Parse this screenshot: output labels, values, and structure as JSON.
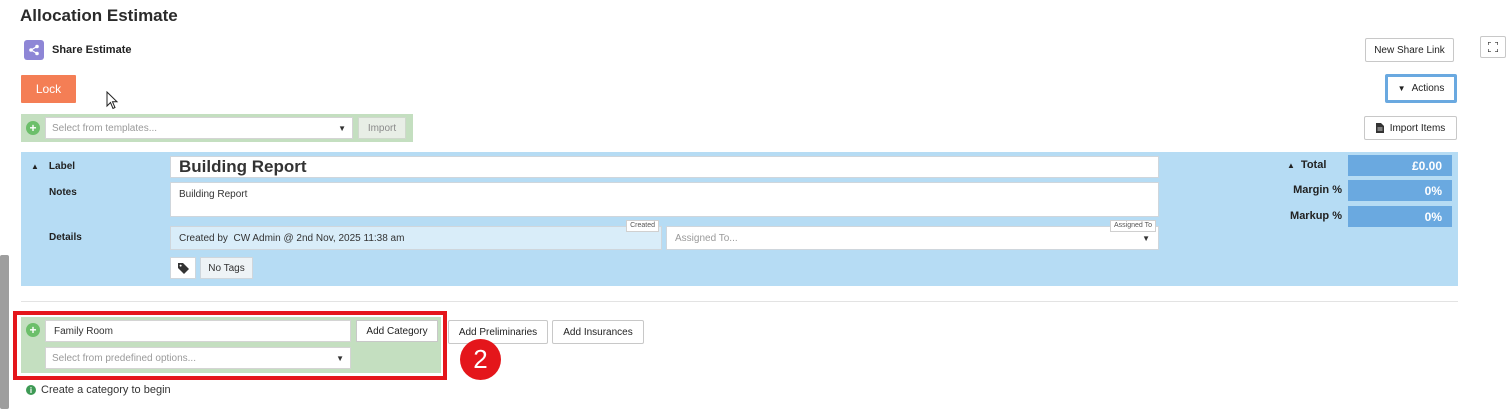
{
  "page": {
    "title": "Allocation Estimate"
  },
  "share": {
    "label": "Share Estimate",
    "new_link_label": "New Share Link"
  },
  "toolbar": {
    "lock_label": "Lock",
    "actions_label": "Actions",
    "import_items_label": "Import Items"
  },
  "templates": {
    "placeholder": "Select from templates...",
    "import_label": "Import"
  },
  "estimate": {
    "label_caption": "Label",
    "label_value": "Building Report",
    "notes_caption": "Notes",
    "notes_value": "Building Report",
    "details_caption": "Details",
    "created_tag": "Created",
    "created_text": "Created by  CW Admin @ 2nd Nov, 2025 11:38 am",
    "assigned_tag": "Assigned To",
    "assigned_placeholder": "Assigned To...",
    "tags_label": "No Tags"
  },
  "totals": {
    "total_label": "Total",
    "total_value": "£0.00",
    "margin_label": "Margin %",
    "margin_value": "0%",
    "markup_label": "Markup %",
    "markup_value": "0%"
  },
  "category": {
    "input_value": "Family Room",
    "add_category_label": "Add Category",
    "predefined_placeholder": "Select from predefined options...",
    "add_preliminaries_label": "Add Preliminaries",
    "add_insurances_label": "Add Insurances",
    "hint": "Create a category to begin"
  },
  "annotation": {
    "step_number": "2"
  },
  "colors": {
    "lock_orange": "#f47e55",
    "panel_blue": "#b6dcf4",
    "total_blue": "#6aa9e0",
    "add_green": "#c4dfc0",
    "highlight_red": "#e4161b"
  }
}
